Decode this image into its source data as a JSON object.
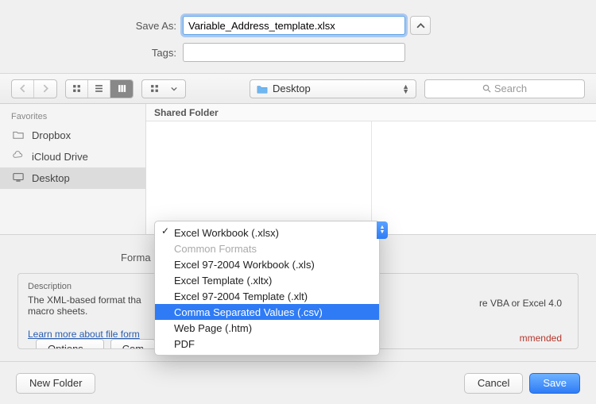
{
  "saveas": {
    "label": "Save As:",
    "value": "Variable_Address_template.xlsx",
    "tags_label": "Tags:",
    "tags_value": ""
  },
  "toolbar": {
    "folder_name": "Desktop",
    "search_placeholder": "Search"
  },
  "sidebar": {
    "header": "Favorites",
    "items": [
      {
        "icon": "folder",
        "label": "Dropbox"
      },
      {
        "icon": "cloud",
        "label": "iCloud Drive"
      },
      {
        "icon": "desktop",
        "label": "Desktop",
        "selected": true
      }
    ]
  },
  "browser": {
    "column_header": "Shared Folder"
  },
  "format": {
    "label": "Forma",
    "menu": {
      "checked": "Excel Workbook (.xlsx)",
      "section": "Common Formats",
      "items": [
        "Excel 97-2004 Workbook (.xls)",
        "Excel Template (.xltx)",
        "Excel 97-2004 Template (.xlt)",
        "Comma Separated Values (.csv)",
        "Web Page (.htm)",
        "PDF"
      ],
      "highlight_index": 3
    }
  },
  "description": {
    "title": "Description",
    "text": "The XML-based format tha",
    "text2": "macro sheets.",
    "right_fragment": "re VBA or Excel 4.0",
    "learn_link": "Learn more about file form"
  },
  "buttons": {
    "options": "Options...",
    "compat": "Com",
    "recommended_fragment": "mmended",
    "new_folder": "New Folder",
    "cancel": "Cancel",
    "save": "Save"
  }
}
